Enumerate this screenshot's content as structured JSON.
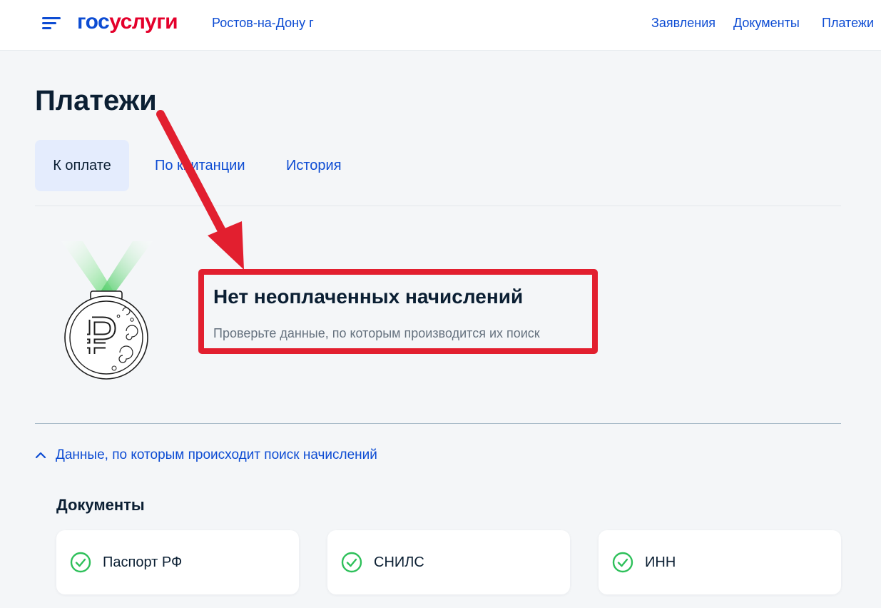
{
  "header": {
    "logo_part1": "гос",
    "logo_part2": "услуги",
    "city": "Ростов-на-Дону г",
    "nav": [
      "Заявления",
      "Документы",
      "Платежи"
    ]
  },
  "page": {
    "title": "Платежи"
  },
  "tabs": [
    {
      "label": "К оплате",
      "active": true
    },
    {
      "label": "По квитанции",
      "active": false
    },
    {
      "label": "История",
      "active": false
    }
  ],
  "message": {
    "title": "Нет неоплаченных начислений",
    "subtitle": "Проверьте данные, по которым производится их поиск"
  },
  "expander": {
    "label": "Данные, по которым происходит поиск начислений"
  },
  "documents": {
    "title": "Документы",
    "items": [
      {
        "label": "Паспорт РФ"
      },
      {
        "label": "СНИЛС"
      },
      {
        "label": "ИНН"
      }
    ]
  },
  "colors": {
    "brand_blue": "#0d4cd3",
    "brand_red": "#e4002b",
    "annotation_red": "#e21f2f",
    "success_green": "#2ec05a"
  }
}
